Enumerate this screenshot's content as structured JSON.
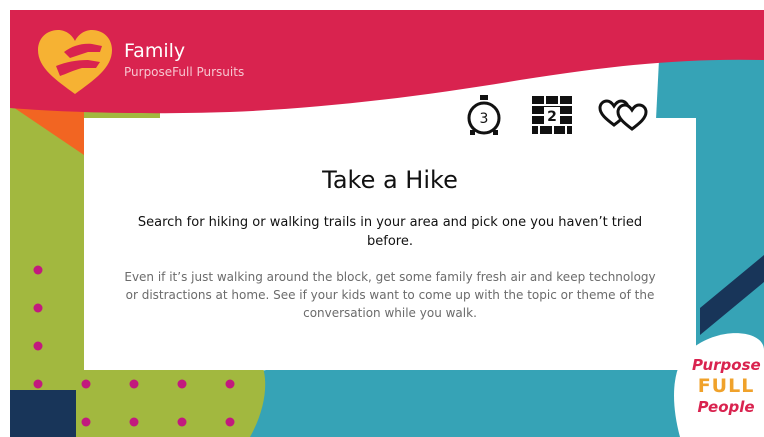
{
  "header": {
    "title": "Family",
    "subtitle": "PurposeFull Pursuits"
  },
  "meta_icons": {
    "time_value": "3",
    "level_value": "2",
    "time_icon": "stopwatch-icon",
    "level_icon": "brick-wall-icon",
    "hearts_icon": "two-hearts-icon"
  },
  "card": {
    "title": "Take a Hike",
    "lead": "Search for hiking or walking trails in your area and pick one you haven’t tried before.",
    "body": "Even if it’s just walking around the block, get some family fresh air and keep technology or distractions at home. See if your kids want to come up with the topic or theme of the conversation while you walk."
  },
  "brand": {
    "line1": "Purpose",
    "line2": "FULL",
    "line3": "People"
  },
  "colors": {
    "header_pink": "#d9234f",
    "lime": "#a2b83f",
    "teal": "#36a3b6",
    "navy": "#183559",
    "orange": "#f26522",
    "magenta_dot": "#c21a7e",
    "logo_yellow": "#f6b233"
  }
}
